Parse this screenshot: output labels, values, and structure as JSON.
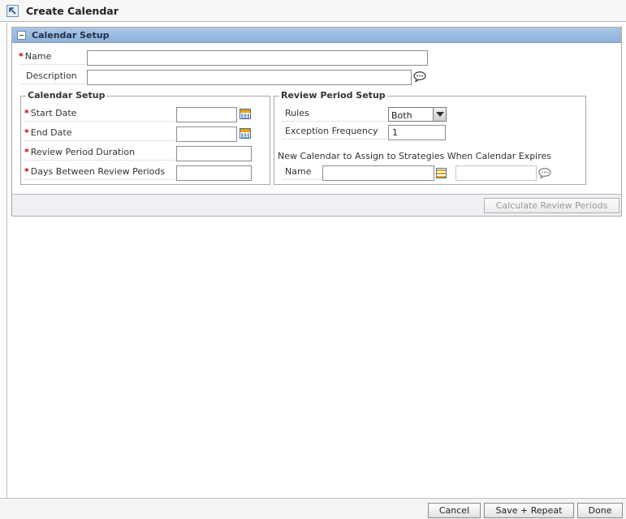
{
  "page": {
    "title": "Create Calendar"
  },
  "calendar_setup_panel": {
    "title": "Calendar Setup",
    "name_label": "Name",
    "name_value": "",
    "description_label": "Description",
    "description_value": "",
    "required_marker": "*"
  },
  "calendar_setup_group": {
    "legend": "Calendar Setup",
    "start_date_label": "Start Date",
    "start_date_value": "",
    "end_date_label": "End Date",
    "end_date_value": "",
    "review_period_duration_label": "Review Period Duration",
    "review_period_duration_value": "",
    "days_between_label": "Days Between Review Periods",
    "days_between_value": ""
  },
  "review_period_group": {
    "legend": "Review Period Setup",
    "rules_label": "Rules",
    "rules_value": "Both",
    "exception_frequency_label": "Exception Frequency",
    "exception_frequency_value": "1",
    "new_calendar_label": "New Calendar to Assign to Strategies When Calendar Expires",
    "new_calendar_name_label": "Name",
    "new_calendar_name_value": "",
    "new_calendar_description_value": ""
  },
  "panel_footer": {
    "calculate_label": "Calculate Review Periods"
  },
  "bottom_bar": {
    "cancel_label": "Cancel",
    "save_repeat_label": "Save + Repeat",
    "done_label": "Done"
  },
  "icons": {
    "title": "arrow-up-left-icon",
    "calendar": "calendar-icon",
    "list": "list-icon",
    "bubble": "speech-bubble-icon"
  },
  "colors": {
    "panel_header": "#9ebde1",
    "required": "#c00000",
    "footer_bg": "#eef0f5"
  }
}
